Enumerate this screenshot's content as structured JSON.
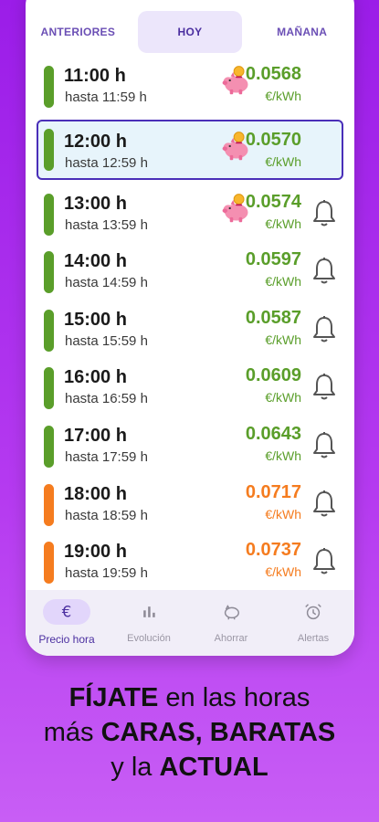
{
  "tabs": [
    {
      "label": "ANTERIORES",
      "active": false
    },
    {
      "label": "HOY",
      "active": true
    },
    {
      "label": "MAÑANA",
      "active": false
    }
  ],
  "rows": [
    {
      "hour": "11:00 h",
      "until": "hasta 11:59 h",
      "price": "0.0568",
      "unit": "€/kWh",
      "level": "green",
      "pig": true,
      "bell": false,
      "current": false
    },
    {
      "hour": "12:00 h",
      "until": "hasta 12:59 h",
      "price": "0.0570",
      "unit": "€/kWh",
      "level": "green",
      "pig": true,
      "bell": false,
      "current": true
    },
    {
      "hour": "13:00 h",
      "until": "hasta 13:59 h",
      "price": "0.0574",
      "unit": "€/kWh",
      "level": "green",
      "pig": true,
      "bell": true,
      "current": false
    },
    {
      "hour": "14:00 h",
      "until": "hasta 14:59 h",
      "price": "0.0597",
      "unit": "€/kWh",
      "level": "green",
      "pig": false,
      "bell": true,
      "current": false
    },
    {
      "hour": "15:00 h",
      "until": "hasta 15:59 h",
      "price": "0.0587",
      "unit": "€/kWh",
      "level": "green",
      "pig": false,
      "bell": true,
      "current": false
    },
    {
      "hour": "16:00 h",
      "until": "hasta 16:59 h",
      "price": "0.0609",
      "unit": "€/kWh",
      "level": "green",
      "pig": false,
      "bell": true,
      "current": false
    },
    {
      "hour": "17:00 h",
      "until": "hasta 17:59 h",
      "price": "0.0643",
      "unit": "€/kWh",
      "level": "green",
      "pig": false,
      "bell": true,
      "current": false
    },
    {
      "hour": "18:00 h",
      "until": "hasta 18:59 h",
      "price": "0.0717",
      "unit": "€/kWh",
      "level": "orange",
      "pig": false,
      "bell": true,
      "current": false
    },
    {
      "hour": "19:00 h",
      "until": "hasta 19:59 h",
      "price": "0.0737",
      "unit": "€/kWh",
      "level": "orange",
      "pig": false,
      "bell": true,
      "current": false
    }
  ],
  "nav": [
    {
      "label": "Precio hora",
      "icon": "euro-icon",
      "active": true
    },
    {
      "label": "Evolución",
      "icon": "bar-chart-icon",
      "active": false
    },
    {
      "label": "Ahorrar",
      "icon": "piggy-bank-icon",
      "active": false
    },
    {
      "label": "Alertas",
      "icon": "alarm-clock-icon",
      "active": false
    }
  ],
  "caption": {
    "line1_bold": "FÍJATE",
    "line1_rest": " en las horas",
    "line2_start": "más ",
    "line2_bold": "CARAS, BARATAS",
    "line3_start": "y la ",
    "line3_bold": "ACTUAL"
  },
  "colors": {
    "green": "#5a9e2a",
    "orange": "#f57c1f",
    "accent": "#4a2fb8",
    "background": "#a52aec"
  }
}
